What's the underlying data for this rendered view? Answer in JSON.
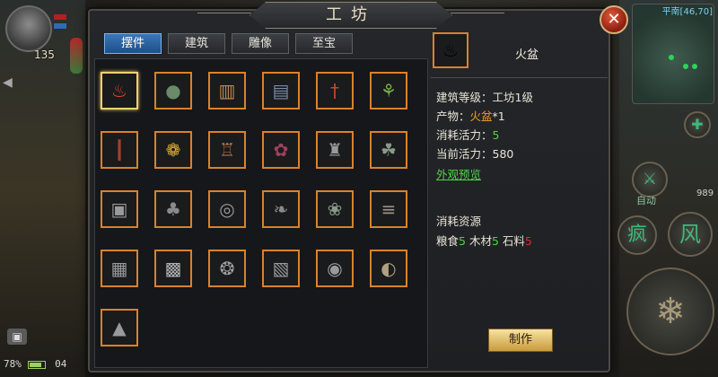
{
  "hud": {
    "player_level": "135",
    "battery_percent": "78%",
    "clock": "04",
    "map_location": "平南[46,70]",
    "skill_buttons": {
      "auto": "自动",
      "skill_1": "疯",
      "skill_2": "风",
      "count": "989"
    }
  },
  "dialog": {
    "title": "工坊",
    "close_icon": "close-icon"
  },
  "tabs": [
    {
      "label": "摆件",
      "active": true
    },
    {
      "label": "建筑",
      "active": false
    },
    {
      "label": "雕像",
      "active": false
    },
    {
      "label": "至宝",
      "active": false
    }
  ],
  "items": [
    {
      "icon": "brazier-icon",
      "selected": true
    },
    {
      "icon": "jar-icon"
    },
    {
      "icon": "stool-icon"
    },
    {
      "icon": "barrels-icon"
    },
    {
      "icon": "lantern-post-icon"
    },
    {
      "icon": "bamboo-icon"
    },
    {
      "icon": "pillar-icon"
    },
    {
      "icon": "yellow-tree-icon"
    },
    {
      "icon": "stone-lantern-icon"
    },
    {
      "icon": "plum-tree-icon"
    },
    {
      "icon": "pagoda-icon"
    },
    {
      "icon": "palm-tree-icon"
    },
    {
      "icon": "box-icon"
    },
    {
      "icon": "pine-tree-icon"
    },
    {
      "icon": "well-icon"
    },
    {
      "icon": "dead-tree-icon"
    },
    {
      "icon": "bonsai-icon"
    },
    {
      "icon": "logs-icon"
    },
    {
      "icon": "table-icon"
    },
    {
      "icon": "cage-lantern-icon"
    },
    {
      "icon": "shrub-icon"
    },
    {
      "icon": "crates-icon"
    },
    {
      "icon": "stone-well-icon"
    },
    {
      "icon": "drum-rack-icon"
    },
    {
      "icon": "rockery-icon"
    }
  ],
  "detail": {
    "name": "火盆",
    "icon": "brazier-icon",
    "building_level_label": "建筑等级：",
    "building_level_value": "工坊1级",
    "product_label": "产物：",
    "product_value": "火盆",
    "product_qty": "*1",
    "stamina_cost_label": "消耗活力：",
    "stamina_cost_value": "5",
    "current_stamina_label": "当前活力：",
    "current_stamina_value": "580",
    "preview_link": "外观预览",
    "resources_title": "消耗资源",
    "resources": [
      {
        "label": "粮食",
        "value": "5",
        "color": "#52d24a"
      },
      {
        "label": "木材",
        "value": "5",
        "color": "#52d24a"
      },
      {
        "label": "石料",
        "value": "5",
        "color": "#e02a2a"
      }
    ],
    "make_button": "制作"
  }
}
